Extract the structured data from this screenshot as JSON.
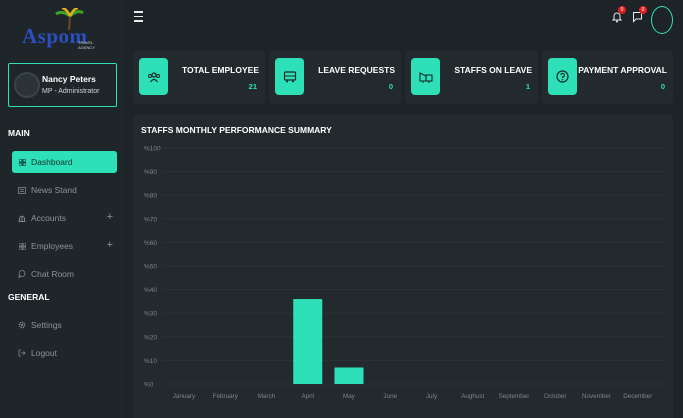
{
  "brand": {
    "logo_text": "Aspom",
    "logo_sub": "TRAVEL AGENCY"
  },
  "profile": {
    "name": "Nancy Peters",
    "role": "MP - Administrator"
  },
  "sidebar": {
    "main_label": "MAIN",
    "general_label": "GENERAL",
    "main_items": [
      {
        "label": "Dashboard",
        "icon": "grid-icon",
        "active": true
      },
      {
        "label": "News Stand",
        "icon": "newspaper-icon"
      },
      {
        "label": "Accounts",
        "icon": "bank-icon",
        "expandable": true
      },
      {
        "label": "Employees",
        "icon": "grid-icon",
        "expandable": true
      },
      {
        "label": "Chat Room",
        "icon": "chat-icon"
      }
    ],
    "general_items": [
      {
        "label": "Settings",
        "icon": "gear-icon"
      },
      {
        "label": "Logout",
        "icon": "logout-icon"
      }
    ],
    "expand_symbol": "+"
  },
  "header": {
    "notifications_badge": "0",
    "messages_badge": "0"
  },
  "cards": [
    {
      "title": "TOTAL EMPLOYEE",
      "count": "21",
      "icon": "people-icon"
    },
    {
      "title": "LEAVE REQUESTS",
      "count": "0",
      "icon": "bus-icon"
    },
    {
      "title": "STAFFS ON LEAVE",
      "count": "1",
      "icon": "travel-icon"
    },
    {
      "title": "PAYMENT APPROVAL",
      "count": "0",
      "icon": "question-icon"
    }
  ],
  "colors": {
    "accent": "#2ee0b8",
    "background": "#1d2326",
    "panel": "#232a2e",
    "badge": "#e02020"
  },
  "chart_data": {
    "type": "bar",
    "title": "STAFFS MONTHLY PERFORMANCE SUMMARY",
    "categories": [
      "January",
      "February",
      "March",
      "April",
      "May",
      "June",
      "July",
      "Aughust",
      "September",
      "October",
      "November",
      "December"
    ],
    "values": [
      0,
      0,
      0,
      36,
      7,
      0,
      0,
      0,
      0,
      0,
      0,
      0
    ],
    "yticks": [
      "%0",
      "%10",
      "%20",
      "%30",
      "%40",
      "%50",
      "%60",
      "%70",
      "%80",
      "%90",
      "%100"
    ],
    "ylim": [
      0,
      100
    ],
    "grid": true
  }
}
